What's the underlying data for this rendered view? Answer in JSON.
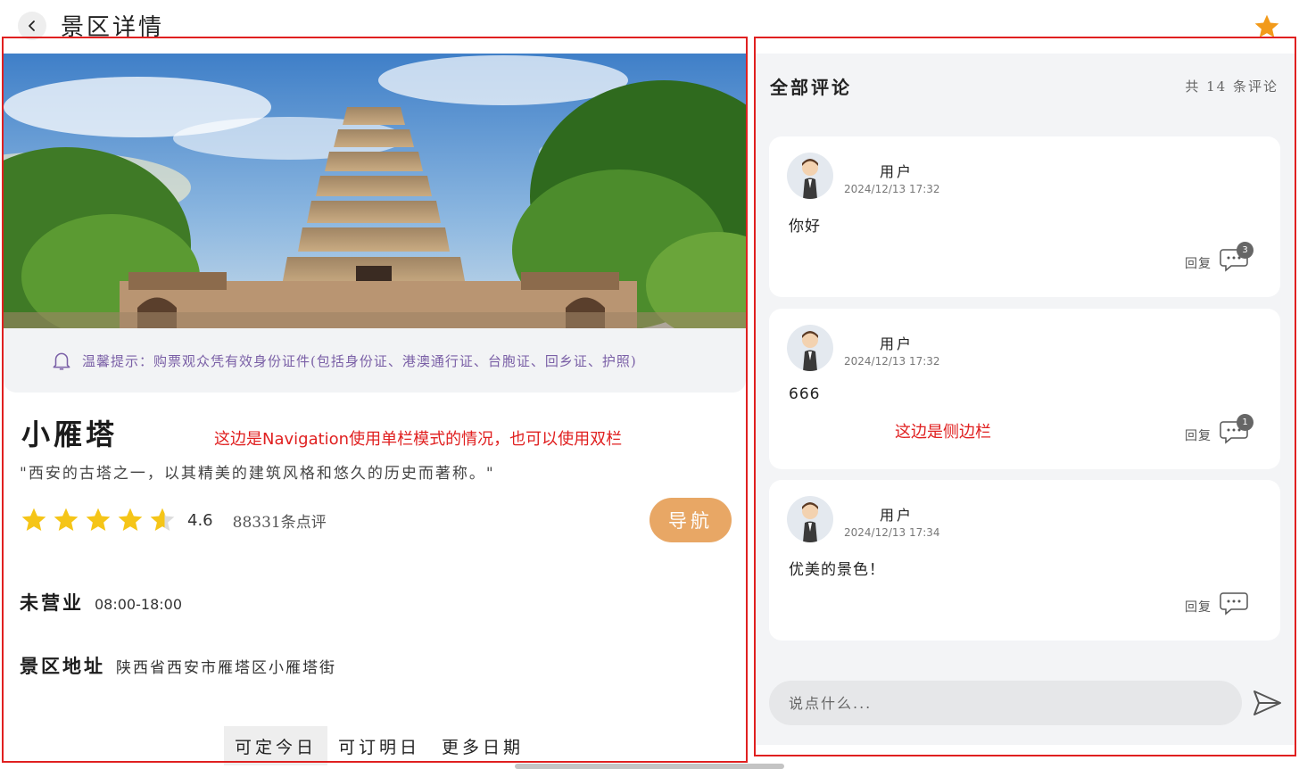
{
  "header": {
    "title": "景区详情"
  },
  "annotations": {
    "left_note": "这边是Navigation使用单栏模式的情况，也可以使用双栏",
    "right_note": "这边是侧边栏"
  },
  "tip": {
    "text": "温馨提示：购票观众凭有效身份证件(包括身份证、港澳通行证、台胞证、回乡证、护照)"
  },
  "spot": {
    "name": "小雁塔",
    "quote": "\"西安的古塔之一，以其精美的建筑风格和悠久的历史而著称。\"",
    "rating": "4.6",
    "rating_value": 4.6,
    "rating_max": 5,
    "review_count": "88331条点评",
    "nav_label": "导航",
    "status_label": "未营业",
    "hours": "08:00-18:00",
    "address_label": "景区地址",
    "address": "陕西省西安市雁塔区小雁塔街"
  },
  "date_tabs": [
    {
      "label": "可定今日",
      "active": true
    },
    {
      "label": "可订明日",
      "active": false
    },
    {
      "label": "更多日期",
      "active": false
    }
  ],
  "comments_panel": {
    "title": "全部评论",
    "total": "共 14 条评论",
    "reply_label": "回复",
    "input_placeholder": "说点什么..."
  },
  "comments": [
    {
      "user": "用户",
      "time": "2024/12/13 17:32",
      "content": "你好",
      "reply_count": "3"
    },
    {
      "user": "用户",
      "time": "2024/12/13 17:32",
      "content": "666",
      "reply_count": "1"
    },
    {
      "user": "用户",
      "time": "2024/12/13 17:34",
      "content": "优美的景色！",
      "reply_count": ""
    }
  ],
  "colors": {
    "accent_orange": "#e8a765",
    "star_gold": "#f5c518",
    "tip_purple": "#7a5fa6",
    "annotation_red": "#e02020",
    "panel_gray": "#f3f4f6"
  },
  "icons": {
    "back": "chevron-left-icon",
    "favorite": "star-icon",
    "tip": "bell-icon",
    "reply": "chat-bubble-icon",
    "send": "send-icon"
  }
}
